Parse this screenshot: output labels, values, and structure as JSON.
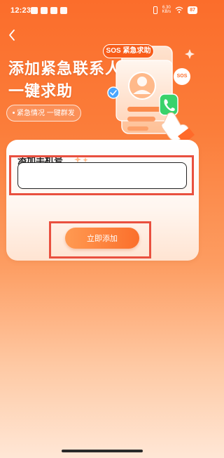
{
  "status_bar": {
    "time": "12:23",
    "net_speed_value": "6.30",
    "net_speed_unit": "KB/s",
    "battery": "87",
    "notification_icons": [
      "telegram-icon",
      "app-icon",
      "app-icon",
      "app-icon"
    ],
    "system_icons": [
      "vibrate-icon",
      "wifi-icon",
      "battery-icon"
    ]
  },
  "header": {
    "back_icon": "chevron-left-icon"
  },
  "hero": {
    "title_line1": "添加紧急联系人",
    "title_line2": "一键求助",
    "subtitle": "紧急情况 一键群发",
    "sos_tag": "SOS 紧急求助",
    "sos_badge": "SOS"
  },
  "form": {
    "title": "添加手机号",
    "phone_value": "",
    "phone_placeholder": "",
    "submit_label": "立即添加"
  },
  "colors": {
    "brand_orange": "#fb6d2b",
    "highlight_red": "#e9503f",
    "button_start": "#ff9a52",
    "button_end": "#fb6f2b"
  }
}
